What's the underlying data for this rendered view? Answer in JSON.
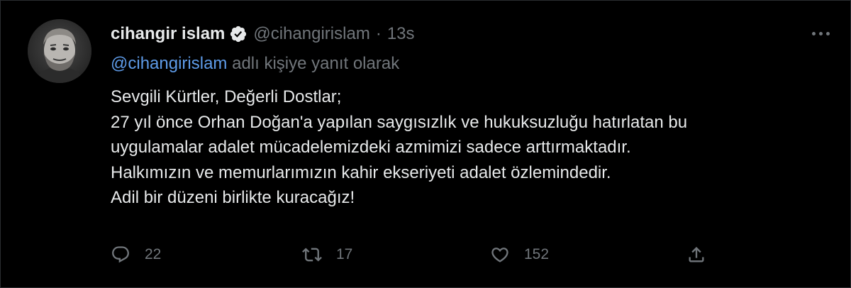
{
  "tweet": {
    "author": {
      "display_name": "cihangir islam",
      "handle": "@cihangirislam",
      "avatar_icon": "profile-photo",
      "verified": true
    },
    "separator": "·",
    "timestamp": "13s",
    "reply_context": {
      "mention": "@cihangirislam",
      "suffix": " adlı kişiye yanıt olarak"
    },
    "text_lines": [
      "Sevgili Kürtler, Değerli Dostlar;",
      "27 yıl önce Orhan Doğan'a yapılan saygısızlık ve hukuksuzluğu hatırlatan bu",
      "uygulamalar adalet mücadelemizdeki azmimizi sadece arttırmaktadır.",
      "Halkımızın ve memurlarımızın kahir ekseriyeti adalet özlemindedir.",
      "Adil bir düzeni birlikte kuracağız!"
    ],
    "actions": {
      "reply": {
        "icon": "reply-icon",
        "count": "22"
      },
      "retweet": {
        "icon": "retweet-icon",
        "count": "17"
      },
      "like": {
        "icon": "heart-icon",
        "count": "152"
      },
      "share": {
        "icon": "share-icon"
      }
    },
    "more_icon": "more-icon"
  },
  "colors": {
    "background": "#000000",
    "primary_text": "#e7e9ea",
    "secondary_text": "#71767b",
    "link": "#5e9be8",
    "verified_badge": "#e7e9ea"
  }
}
